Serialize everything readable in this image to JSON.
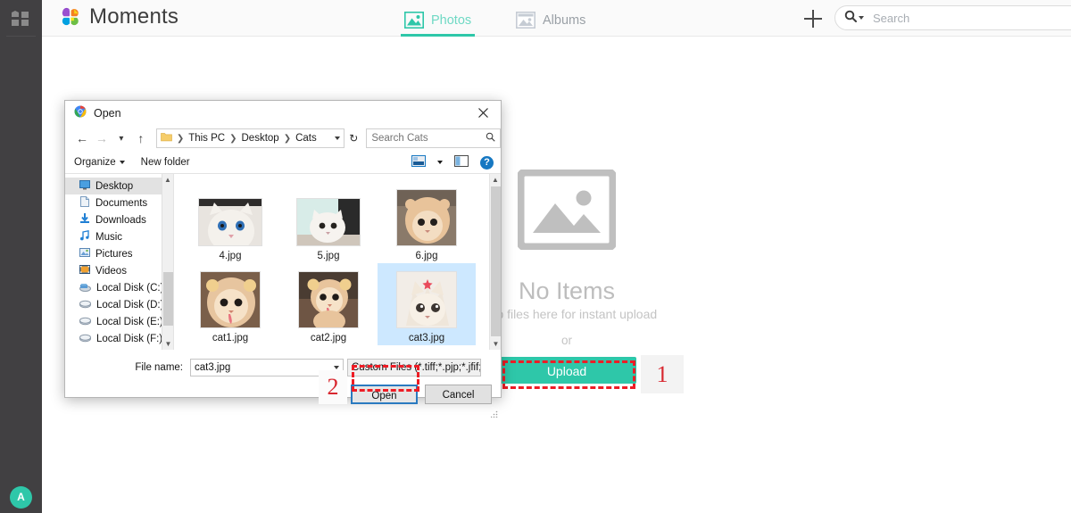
{
  "app": {
    "brand_title": "Moments",
    "brand_logo_icon": "flower-logo-icon",
    "rail_grid_icon": "grid-apps-icon",
    "avatar_initial": "A"
  },
  "topbar": {
    "tabs": [
      {
        "label": "Photos",
        "icon": "photo-icon",
        "active": true
      },
      {
        "label": "Albums",
        "icon": "album-icon",
        "active": false
      }
    ],
    "add_button_icon": "plus-icon",
    "search": {
      "icon": "search-icon",
      "placeholder": "Search",
      "value": ""
    }
  },
  "empty_state": {
    "icon": "image-placeholder-icon",
    "title": "No Items",
    "subtitle": "Drop files here for instant upload",
    "or_text": "or",
    "upload_label": "Upload"
  },
  "annotations": [
    {
      "number": "1",
      "target": "upload-button"
    },
    {
      "number": "2",
      "target": "open-button"
    }
  ],
  "dialog": {
    "title": "Open",
    "title_icon": "chrome-icon",
    "close_icon": "close-icon",
    "nav": {
      "back_icon": "arrow-left-icon",
      "forward_icon": "arrow-right-icon",
      "recent_icon": "chevron-down-icon",
      "up_icon": "arrow-up-icon",
      "refresh_icon": "refresh-icon",
      "folder_icon": "folder-icon",
      "breadcrumb": [
        "This PC",
        "Desktop",
        "Cats"
      ],
      "search_placeholder": "Search Cats",
      "search_icon": "magnifier-icon"
    },
    "toolbar": {
      "organize_label": "Organize",
      "new_folder_label": "New folder",
      "view_icon": "view-layout-icon",
      "view_caret_icon": "chevron-down-icon",
      "pane_icon": "preview-pane-icon",
      "help_icon": "help-icon",
      "help_glyph": "?"
    },
    "tree": [
      {
        "label": "Desktop",
        "icon": "desktop-icon",
        "selected": true
      },
      {
        "label": "Documents",
        "icon": "documents-icon",
        "selected": false
      },
      {
        "label": "Downloads",
        "icon": "downloads-icon",
        "selected": false
      },
      {
        "label": "Music",
        "icon": "music-icon",
        "selected": false
      },
      {
        "label": "Pictures",
        "icon": "pictures-icon",
        "selected": false
      },
      {
        "label": "Videos",
        "icon": "videos-icon",
        "selected": false
      },
      {
        "label": "Local Disk (C:)",
        "icon": "system-drive-icon",
        "selected": false
      },
      {
        "label": "Local Disk (D:)",
        "icon": "drive-icon",
        "selected": false
      },
      {
        "label": "Local Disk (E:)",
        "icon": "drive-icon",
        "selected": false
      },
      {
        "label": "Local Disk (F:)",
        "icon": "drive-icon",
        "selected": false
      }
    ],
    "files": [
      {
        "name": "4.jpg",
        "selected": false
      },
      {
        "name": "5.jpg",
        "selected": false
      },
      {
        "name": "6.jpg",
        "selected": false
      },
      {
        "name": "cat1.jpg",
        "selected": false
      },
      {
        "name": "cat2.jpg",
        "selected": false
      },
      {
        "name": "cat3.jpg",
        "selected": true
      }
    ],
    "footer": {
      "filename_label": "File name:",
      "filename_value": "cat3.jpg",
      "filter_value": "Custom Files (*.tiff;*.pjp;*.jfif;*.b",
      "open_label": "Open",
      "cancel_label": "Cancel"
    }
  },
  "colors": {
    "accent_teal": "#2ec7a9",
    "rail_dark": "#414042",
    "annotation_red": "#ee1c25",
    "tab_active": "#6fd9c4",
    "dialog_focus_blue": "#2a7ac0"
  }
}
